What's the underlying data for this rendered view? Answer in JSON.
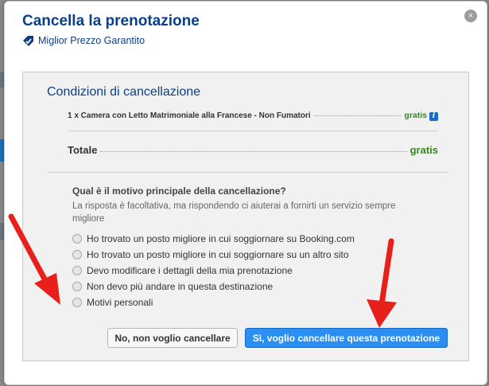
{
  "modal": {
    "title": "Cancella la prenotazione",
    "badge": "Miglior Prezzo Garantito",
    "close_symbol": "×"
  },
  "conditions": {
    "title": "Condizioni di cancellazione",
    "room": {
      "name": "1 x Camera con Letto Matrimoniale alla Francese - Non Fumatori",
      "price": "gratis",
      "info_symbol": "i"
    },
    "total_label": "Totale",
    "total_value": "gratis"
  },
  "reason": {
    "question": "Qual è il motivo principale della cancellazione?",
    "note": "La risposta è facoltativa, ma rispondendo ci aiuterai a fornirti un servizio sempre migliore",
    "options": [
      "Ho trovato un posto migliore in cui soggiornare su Booking.com",
      "Ho trovato un posto migliore in cui soggiornare su un altro sito",
      "Devo modificare i dettagli della mia prenotazione",
      "Non devo più andare in questa destinazione",
      "Motivi personali"
    ]
  },
  "buttons": {
    "decline": "No, non voglio cancellare",
    "confirm": "Sì, voglio cancellare questa prenotazione"
  },
  "colors": {
    "title_blue": "#0b3f86",
    "price_green": "#2e8b1a",
    "confirm_blue": "#2b8ef3",
    "arrow_red": "#e8201c"
  },
  "annotations": [
    "red-arrow",
    "red-arrow"
  ]
}
